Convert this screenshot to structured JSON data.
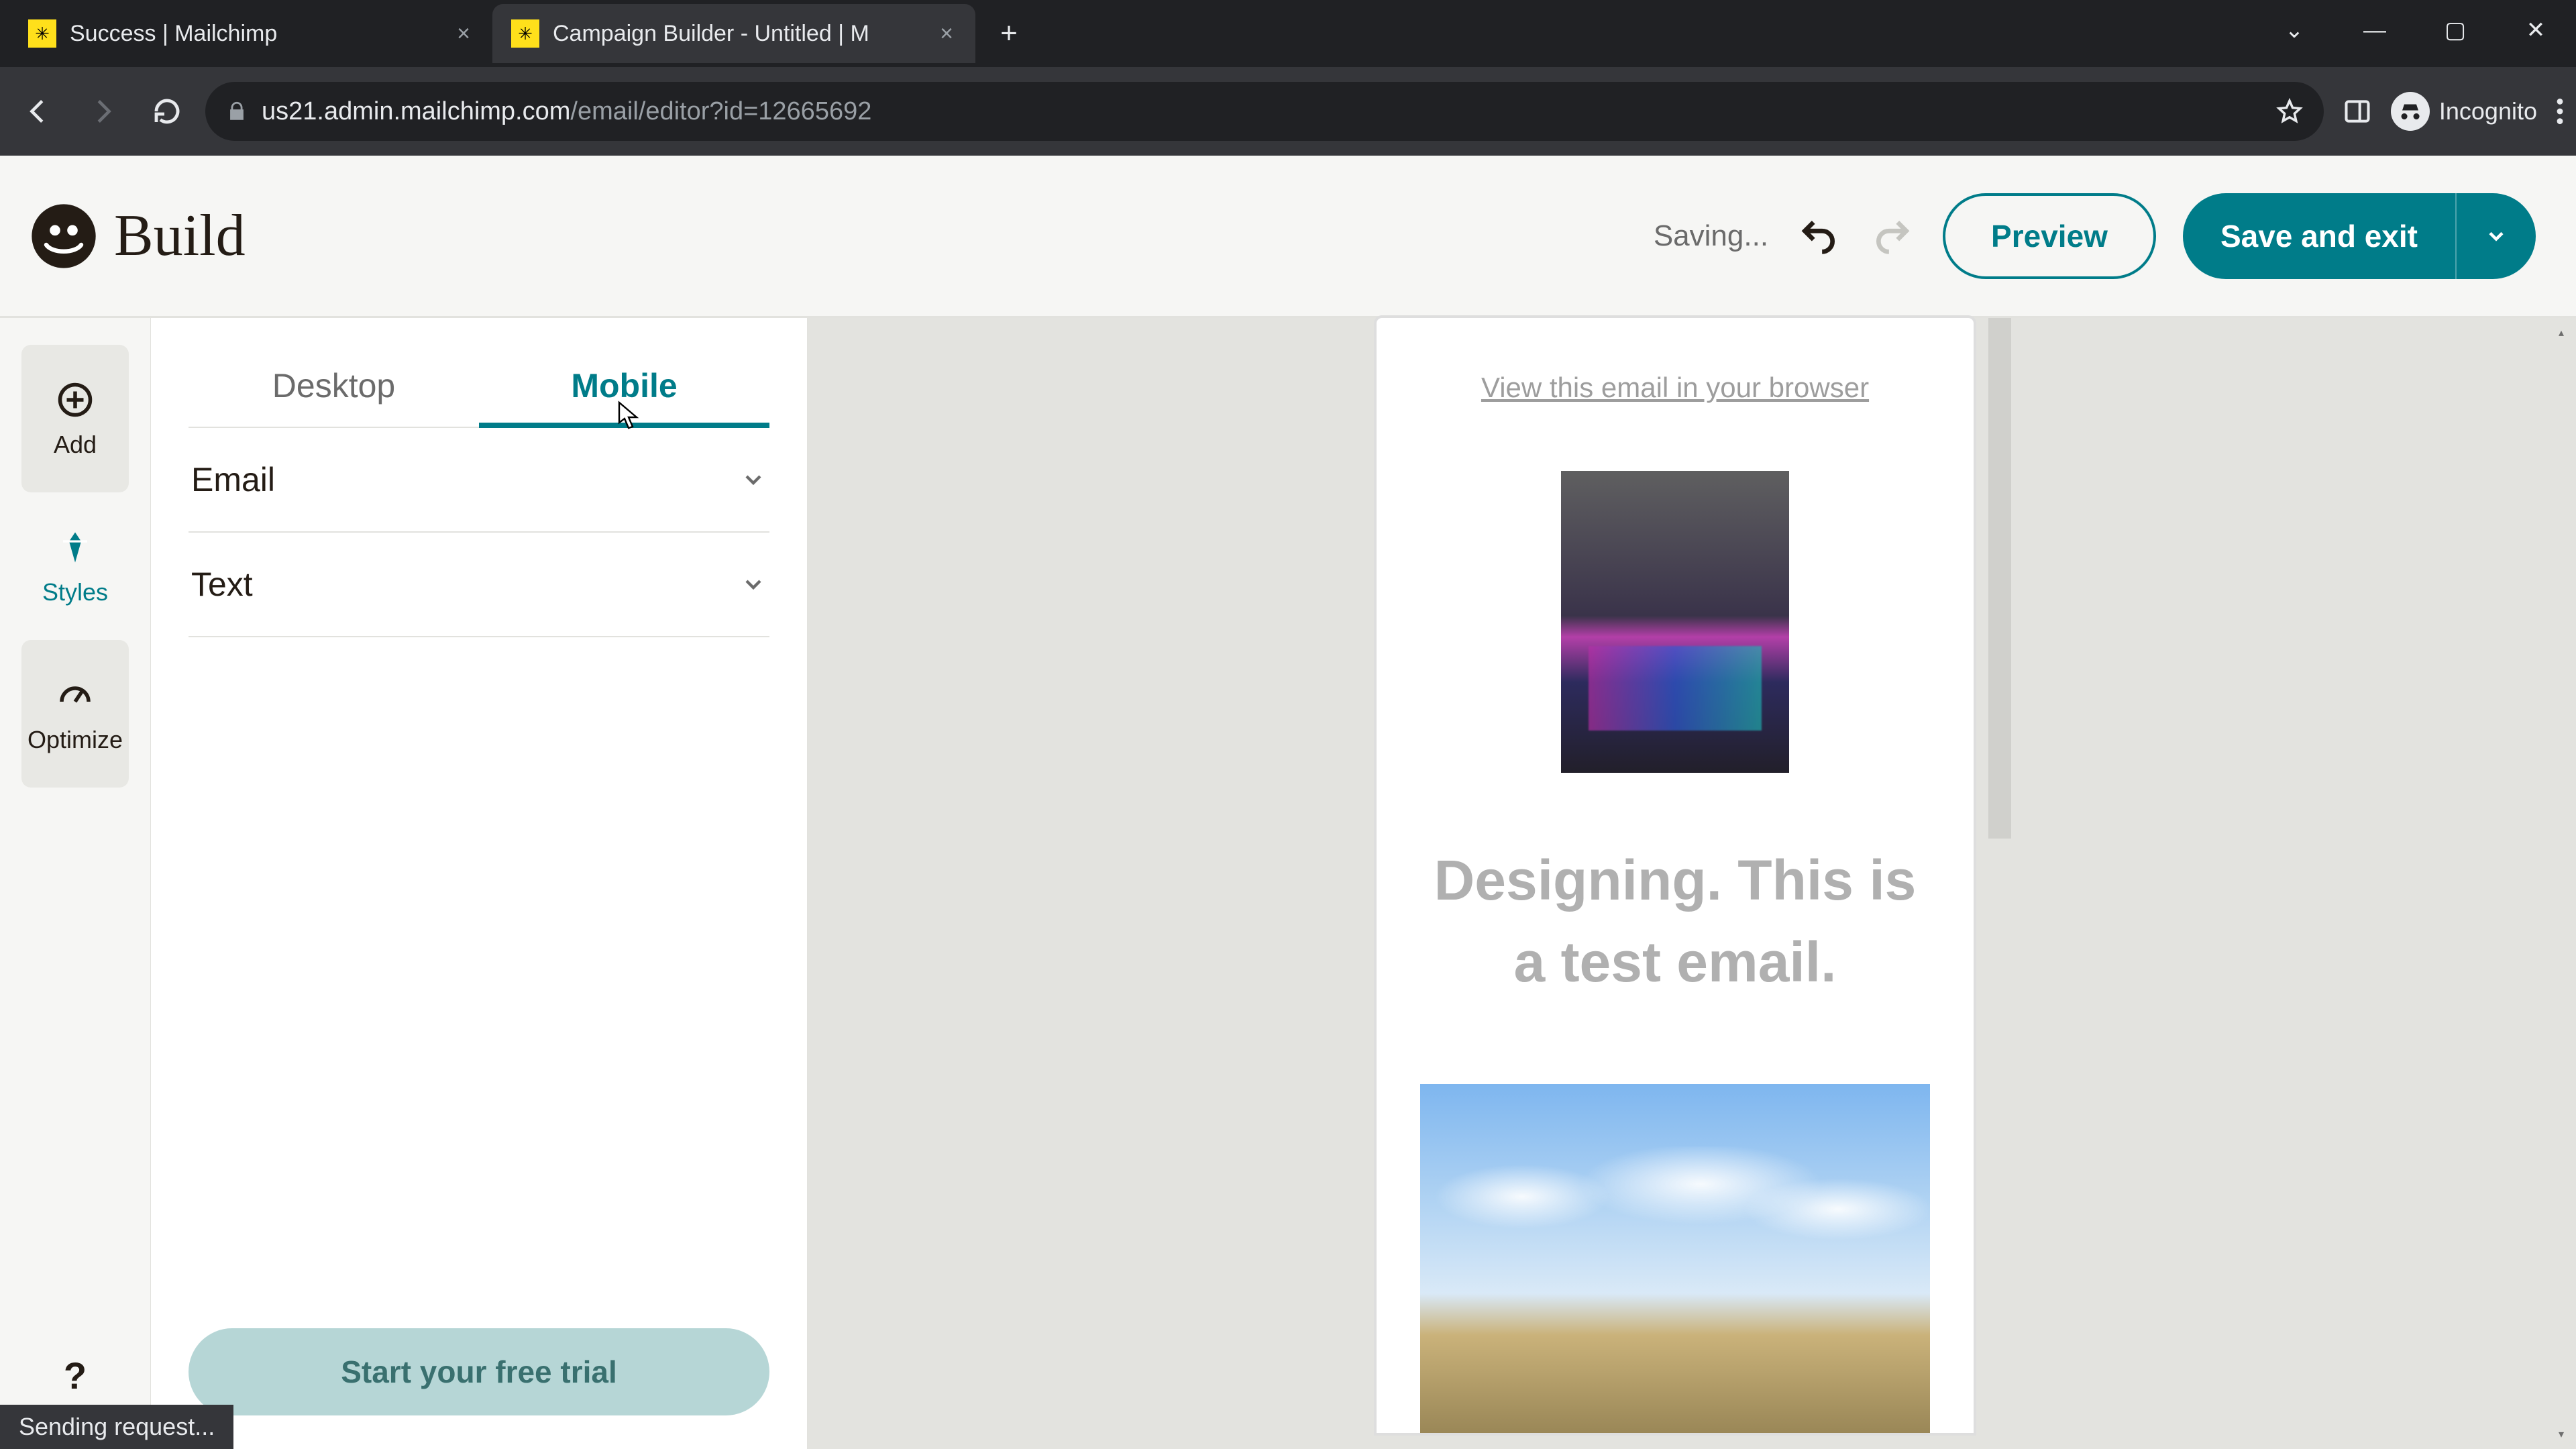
{
  "browser": {
    "tabs": [
      {
        "title": "Success | Mailchimp",
        "active": false
      },
      {
        "title": "Campaign Builder - Untitled | M",
        "active": true
      }
    ],
    "url_host": "us21.admin.mailchimp.com",
    "url_path": "/email/editor?id=12665692",
    "incognito_label": "Incognito"
  },
  "header": {
    "page_title": "Build",
    "saving_text": "Saving...",
    "preview_label": "Preview",
    "save_label": "Save and exit"
  },
  "rail": {
    "add_label": "Add",
    "styles_label": "Styles",
    "optimize_label": "Optimize"
  },
  "styles_panel": {
    "desktop_tab": "Desktop",
    "mobile_tab": "Mobile",
    "active_tab": "Mobile",
    "sections": {
      "email": "Email",
      "text": "Text"
    },
    "trial_button": "Start your free trial"
  },
  "email_preview": {
    "view_in_browser": "View this email in your browser",
    "heading": "Designing. This is a test email."
  },
  "status_bar": "Sending request...",
  "help_label": "?",
  "colors": {
    "accent": "#007c89",
    "brand_yellow": "#ffe01b"
  }
}
